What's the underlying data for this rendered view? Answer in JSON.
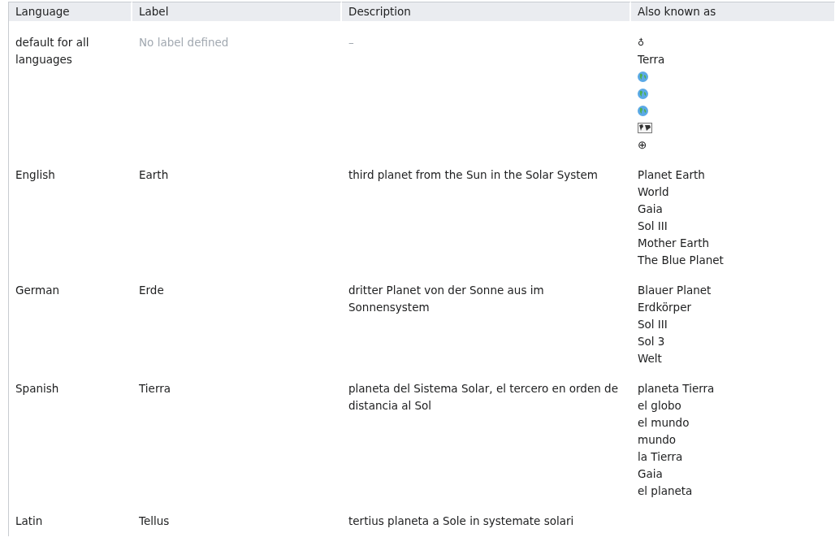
{
  "table": {
    "columns": [
      "Language",
      "Label",
      "Description",
      "Also known as"
    ],
    "rows": [
      {
        "language": "default for all languages",
        "label": "No label defined",
        "label_missing": true,
        "description": "–",
        "description_missing": true,
        "aliases": [
          {
            "kind": "text",
            "text": "♁"
          },
          {
            "kind": "text",
            "text": "Terra"
          },
          {
            "kind": "globe"
          },
          {
            "kind": "globe"
          },
          {
            "kind": "globe"
          },
          {
            "kind": "map"
          },
          {
            "kind": "text",
            "text": "⊕"
          }
        ]
      },
      {
        "language": "English",
        "label": "Earth",
        "label_missing": false,
        "description": "third planet from the Sun in the Solar System",
        "description_missing": false,
        "aliases": [
          {
            "kind": "text",
            "text": "Planet Earth"
          },
          {
            "kind": "text",
            "text": "World"
          },
          {
            "kind": "text",
            "text": "Gaia"
          },
          {
            "kind": "text",
            "text": "Sol III"
          },
          {
            "kind": "text",
            "text": "Mother Earth"
          },
          {
            "kind": "text",
            "text": "The Blue Planet"
          }
        ]
      },
      {
        "language": "German",
        "label": "Erde",
        "label_missing": false,
        "description": "dritter Planet von der Sonne aus im Sonnensystem",
        "description_missing": false,
        "aliases": [
          {
            "kind": "text",
            "text": "Blauer Planet"
          },
          {
            "kind": "text",
            "text": "Erdkörper"
          },
          {
            "kind": "text",
            "text": "Sol III"
          },
          {
            "kind": "text",
            "text": "Sol 3"
          },
          {
            "kind": "text",
            "text": "Welt"
          }
        ]
      },
      {
        "language": "Spanish",
        "label": "Tierra",
        "label_missing": false,
        "description": "planeta del Sistema Solar, el tercero en orden de distancia al Sol",
        "description_missing": false,
        "aliases": [
          {
            "kind": "text",
            "text": "planeta Tierra"
          },
          {
            "kind": "text",
            "text": "el globo"
          },
          {
            "kind": "text",
            "text": "el mundo"
          },
          {
            "kind": "text",
            "text": "mundo"
          },
          {
            "kind": "text",
            "text": "la Tierra"
          },
          {
            "kind": "text",
            "text": "Gaia"
          },
          {
            "kind": "text",
            "text": "el planeta"
          }
        ]
      },
      {
        "language": "Latin",
        "label": "Tellus",
        "label_missing": false,
        "description": "tertius planeta a Sole in systemate solari",
        "description_missing": false,
        "aliases": []
      }
    ]
  }
}
